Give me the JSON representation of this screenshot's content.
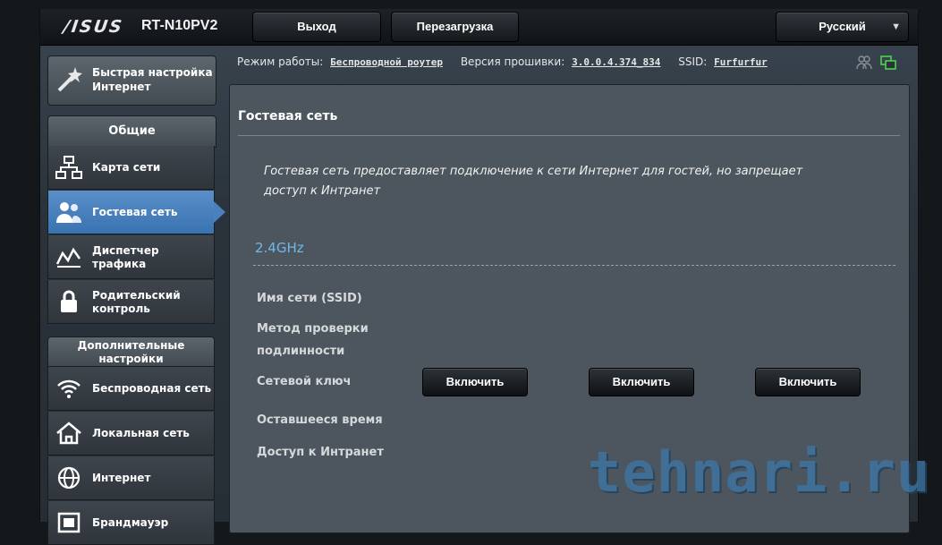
{
  "header": {
    "brand": "/ISUS",
    "model": "RT-N10PV2",
    "logout_label": "Выход",
    "reboot_label": "Перезагрузка",
    "language": "Русский"
  },
  "info": {
    "mode_label": "Режим работы:",
    "mode_value": "Беспроводной роутер",
    "firmware_label": "Версия прошивки:",
    "firmware_value": "3.0.0.4.374_834",
    "ssid_label": "SSID:",
    "ssid_value": "Furfurfur"
  },
  "sidebar": {
    "quick_setup": "Быстрая настройка Интернет",
    "general_header": "Общие",
    "general_items": [
      {
        "label": "Карта сети",
        "icon": "network-map-icon"
      },
      {
        "label": "Гостевая сеть",
        "icon": "guest-network-icon"
      },
      {
        "label": "Диспетчер трафика",
        "icon": "traffic-manager-icon"
      },
      {
        "label": "Родительский контроль",
        "icon": "parental-control-icon"
      }
    ],
    "advanced_header": "Дополнительные настройки",
    "advanced_items": [
      {
        "label": "Беспроводная сеть",
        "icon": "wireless-icon"
      },
      {
        "label": "Локальная сеть",
        "icon": "lan-icon"
      },
      {
        "label": "Интернет",
        "icon": "globe-icon"
      },
      {
        "label": "Брандмауэр",
        "icon": "firewall-icon"
      }
    ]
  },
  "main": {
    "title": "Гостевая сеть",
    "description": "Гостевая сеть предоставляет подключение к сети Интернет для гостей, но запрещает доступ к Интранет",
    "band": "2.4GHz",
    "fields": [
      "Имя сети (SSID)",
      "Метод проверки подлинности",
      "Сетевой ключ",
      "Оставшееся время",
      "Доступ к Интранет"
    ],
    "enable_label": "Включить"
  },
  "watermark": "tehnari.ru",
  "colors": {
    "accent_active": "#4a80bd",
    "band_text": "#6fb8e8",
    "status_icon_green": "#4fd24f"
  }
}
